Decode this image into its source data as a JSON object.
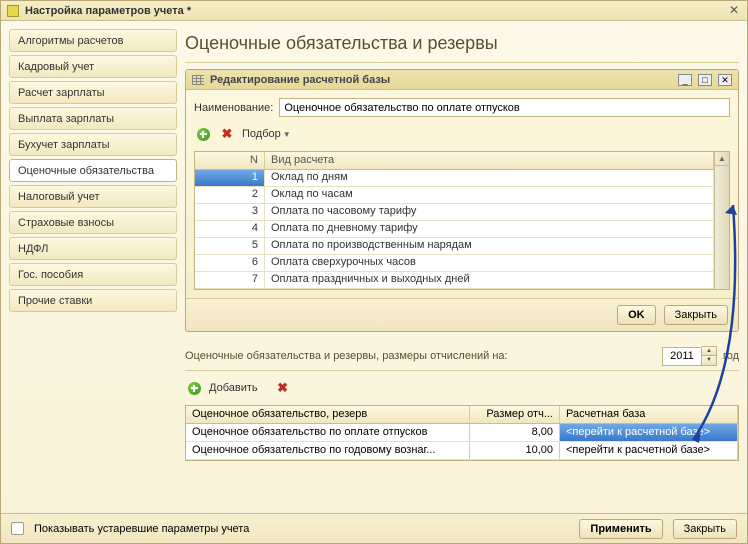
{
  "window": {
    "title": "Настройка параметров учета *"
  },
  "sidebar": {
    "items": [
      {
        "label": "Алгоритмы расчетов"
      },
      {
        "label": "Кадровый учет"
      },
      {
        "label": "Расчет зарплаты"
      },
      {
        "label": "Выплата зарплаты"
      },
      {
        "label": "Бухучет зарплаты"
      },
      {
        "label": "Оценочные обязательства"
      },
      {
        "label": "Налоговый учет"
      },
      {
        "label": "Страховые взносы"
      },
      {
        "label": "НДФЛ"
      },
      {
        "label": "Гос. пособия"
      },
      {
        "label": "Прочие ставки"
      }
    ],
    "active_index": 5
  },
  "page": {
    "title": "Оценочные обязательства и резервы"
  },
  "dialog": {
    "title": "Редактирование расчетной базы",
    "name_label": "Наименование:",
    "name_value": "Оценочное обязательство по оплате отпусков",
    "pick_label": "Подбор",
    "columns": {
      "n": "N",
      "type": "Вид расчета"
    },
    "rows": [
      {
        "n": "1",
        "type": "Оклад по дням"
      },
      {
        "n": "2",
        "type": "Оклад по часам"
      },
      {
        "n": "3",
        "type": "Оплата по часовому тарифу"
      },
      {
        "n": "4",
        "type": "Оплата по дневному тарифу"
      },
      {
        "n": "5",
        "type": "Оплата по производственным нарядам"
      },
      {
        "n": "6",
        "type": "Оплата сверхурочных часов"
      },
      {
        "n": "7",
        "type": "Оплата праздничных и выходных дней"
      }
    ],
    "ok": "OK",
    "close": "Закрыть"
  },
  "section": {
    "label": "Оценочные обязательства и резервы, размеры отчислений на:",
    "year": "2011",
    "year_suffix": "год",
    "add_label": "Добавить"
  },
  "btable": {
    "columns": {
      "name": "Оценочное обязательство, резерв",
      "size": "Размер отч...",
      "base": "Расчетная база"
    },
    "rows": [
      {
        "name": "Оценочное обязательство по оплате отпусков",
        "size": "8,00",
        "base": "<перейти к расчетной базе>"
      },
      {
        "name": "Оценочное обязательство по годовому вознаг...",
        "size": "10,00",
        "base": "<перейти к расчетной базе>"
      }
    ]
  },
  "bottom": {
    "checkbox_label": "Показывать устаревшие параметры учета",
    "apply": "Применить",
    "close": "Закрыть"
  }
}
